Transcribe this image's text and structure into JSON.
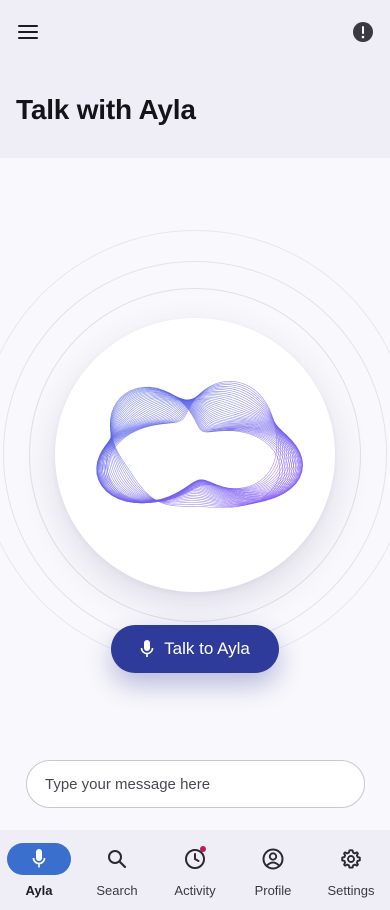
{
  "header": {
    "title": "Talk with Ayla",
    "menu_icon": "hamburger-menu-icon",
    "info_icon": "alert-circle-icon"
  },
  "main": {
    "talk_button_label": "Talk to Ayla",
    "talk_button_icon": "microphone-icon",
    "message_placeholder": "Type your message here",
    "visual": "ayla-wave-orb"
  },
  "nav": {
    "items": [
      {
        "label": "Ayla",
        "icon": "microphone-icon",
        "active": true
      },
      {
        "label": "Search",
        "icon": "search-icon",
        "active": false
      },
      {
        "label": "Activity",
        "icon": "clock-icon",
        "active": false,
        "badge": true
      },
      {
        "label": "Profile",
        "icon": "profile-icon",
        "active": false
      },
      {
        "label": "Settings",
        "icon": "gear-icon",
        "active": false
      }
    ]
  },
  "colors": {
    "primary_button": "#2f3b9a",
    "active_nav": "#3b6fce",
    "badge": "#c2185b",
    "wave_start": "#4a63e0",
    "wave_end": "#8b5cf6"
  }
}
